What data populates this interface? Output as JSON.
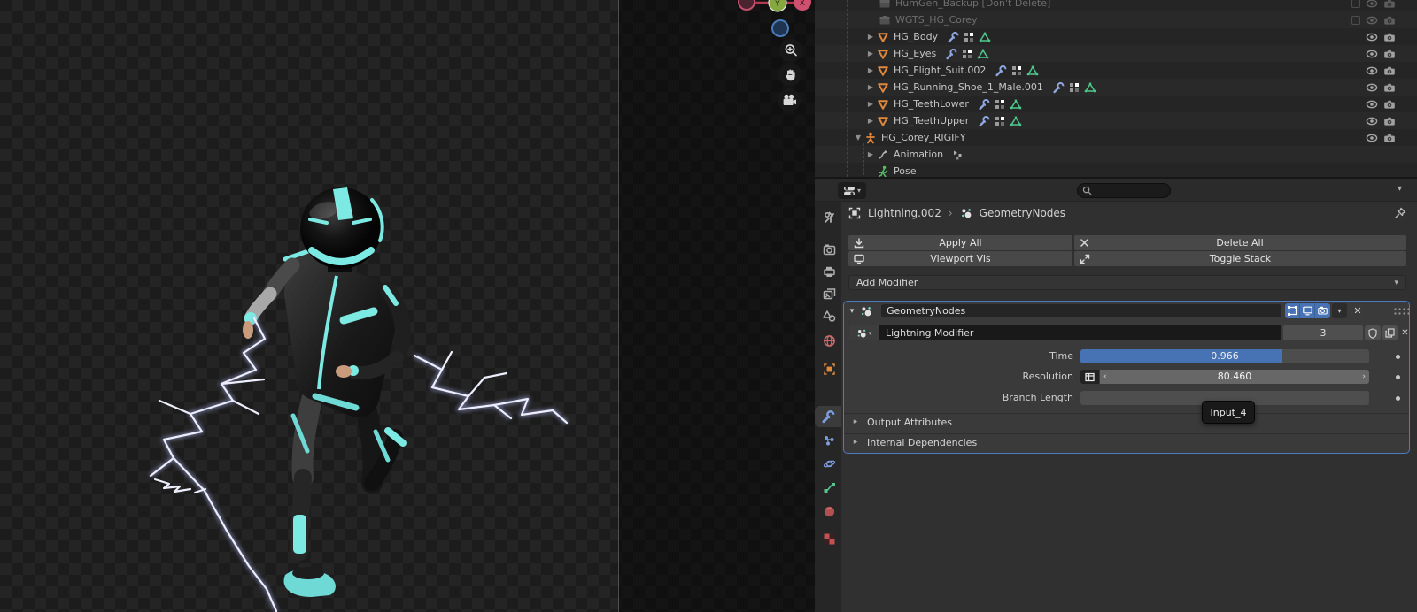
{
  "viewport": {
    "gizmo": {
      "y_label": "Y",
      "x_label": "X"
    }
  },
  "outliner": {
    "rows": [
      {
        "label": "HumGen_Backup [Don't Delete]"
      },
      {
        "label": "WGTS_HG_Corey"
      },
      {
        "label": "HG_Body"
      },
      {
        "label": "HG_Eyes"
      },
      {
        "label": "HG_Flight_Suit.002"
      },
      {
        "label": "HG_Running_Shoe_1_Male.001"
      },
      {
        "label": "HG_TeethLower"
      },
      {
        "label": "HG_TeethUpper"
      },
      {
        "label": "HG_Corey_RIGIFY"
      },
      {
        "label": "Animation"
      },
      {
        "label": "Pose"
      }
    ]
  },
  "properties": {
    "breadcrumb": {
      "object": "Lightning.002",
      "data": "GeometryNodes"
    },
    "actions": {
      "apply_all": "Apply All",
      "delete_all": "Delete All",
      "viewport_vis": "Viewport Vis",
      "toggle_stack": "Toggle Stack"
    },
    "add_modifier": "Add Modifier",
    "modifier": {
      "title": "GeometryNodes",
      "node_group": "Lightning Modifier",
      "users": "3",
      "time_label": "Time",
      "time_value": "0.966",
      "resolution_label": "Resolution",
      "resolution_value": "80.460",
      "branch_label": "Branch Length",
      "tooltip": "Input_4",
      "subpanel_output": "Output Attributes",
      "subpanel_internal": "Internal Dependencies"
    }
  },
  "colors": {
    "accent": "#4772b3",
    "cyan": "#7ce9e3",
    "orange": "#e0883c",
    "mesh_green": "#4ec98c"
  }
}
